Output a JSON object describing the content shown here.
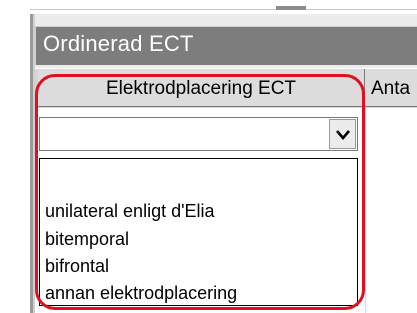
{
  "window": {
    "title": "Ordinerad ECT"
  },
  "table": {
    "columns": [
      "Elektrodplacering ECT",
      "Anta"
    ]
  },
  "combo": {
    "value": "",
    "options": [
      "",
      "unilateral enligt d'Elia",
      "bitemporal",
      "bifrontal",
      "annan elektrodplacering"
    ]
  },
  "colors": {
    "highlight": "#e01020",
    "titlebar": "#7d7d7d"
  },
  "icons": {
    "combo_button": "chevron-down-icon"
  }
}
